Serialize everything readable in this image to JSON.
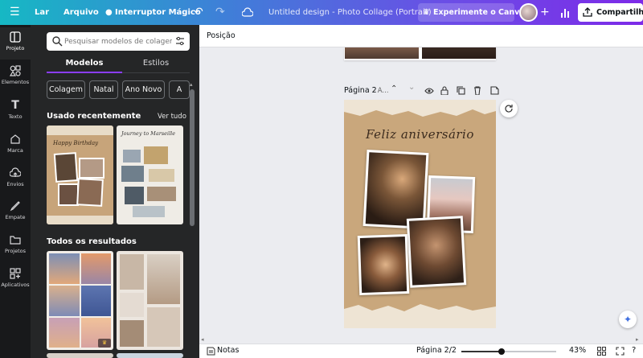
{
  "topbar": {
    "menu_icon": "menu-icon",
    "home_label": "Lar",
    "file_label": "Arquivo",
    "magic_switch_label": "Interruptor Mágico",
    "doc_title": "Untitled design - Photo Collage (Portrait)",
    "trial_label": "Experimente o Canva ...",
    "share_label": "Compartilhar"
  },
  "rail": {
    "items": [
      {
        "label": "Projeto",
        "icon": "layout-icon"
      },
      {
        "label": "Elementos",
        "icon": "elements-icon"
      },
      {
        "label": "Texto",
        "icon": "text-icon"
      },
      {
        "label": "Marca",
        "icon": "brand-icon"
      },
      {
        "label": "Envios",
        "icon": "upload-icon"
      },
      {
        "label": "Empate",
        "icon": "draw-icon"
      },
      {
        "label": "Projetos",
        "icon": "folder-icon"
      },
      {
        "label": "Aplicativos",
        "icon": "apps-icon"
      }
    ]
  },
  "panel": {
    "search_placeholder": "Pesquisar modelos de colagem de fo",
    "tabs": [
      "Modelos",
      "Estilos"
    ],
    "chips": [
      "Colagem",
      "Natal",
      "Ano Novo",
      "A"
    ],
    "recent_title": "Usado recentemente",
    "see_all": "Ver tudo",
    "all_results_title": "Todos os resultados",
    "template1_text": "Happy Birthday",
    "template2_text": "Journey to Marseille"
  },
  "canvas": {
    "position_label": "Posição",
    "page_label": "Página 2",
    "page_title_placeholder": "- A...",
    "card_heading": "Feliz aniversário"
  },
  "bottombar": {
    "notes_label": "Notas",
    "page_indicator": "Página 2/2",
    "zoom_value": "43%",
    "zoom_fraction": 0.43
  },
  "colors": {
    "accent": "#8b3dff",
    "panel_bg": "#252627",
    "rail_bg": "#18191b",
    "canvas_bg": "#ebecf0",
    "kraft": "#c9a77c"
  }
}
